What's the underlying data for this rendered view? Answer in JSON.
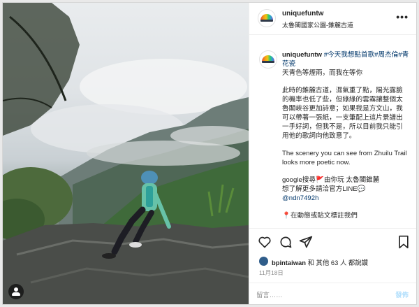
{
  "post": {
    "username": "uniquefuntw",
    "location": "太魯閣國家公園-錐麓古道",
    "more_icon": "more-horizontal-icon"
  },
  "caption": {
    "username": "uniquefuntw",
    "hashtags": "#今天我想點首歌#周杰倫#青花瓷",
    "line1": "天青色等煙雨，而我在等你",
    "para1": "此時的錐麓古道，濕氣重了點，陽光露臉的機率也低了些，但綠綠的雲霧讓整個太魯閣峽谷更加詩意；如果我是方文山，我可以帶著一張紙，一支筆配上這片景譜出一手好詞，但我不是，所以目前我只能引用他的歌詞向他致意了。",
    "para2": "The scenery you can see from Zhuilu Trail looks more poetic now.",
    "promo_line1": "google搜尋🚩由你玩 太魯閣錐麓",
    "promo_line2": "想了解更多請洽官方LINE💬",
    "promo_line3": "@ndn7492h",
    "promo_line4": "📍在動態或貼文標註我們"
  },
  "actions": {
    "like_icon": "heart-icon",
    "comment_icon": "comment-icon",
    "share_icon": "share-icon",
    "save_icon": "bookmark-icon"
  },
  "likes": {
    "liker": "bpintaiwan",
    "text": "和 其他 63 人 都說讚"
  },
  "date": "11月18日",
  "comment": {
    "placeholder": "留言……",
    "post_label": "發佈"
  },
  "colors": {
    "link": "#00376b",
    "post_button_disabled": "#b2dffc",
    "secondary_text": "#8e8e8e"
  }
}
